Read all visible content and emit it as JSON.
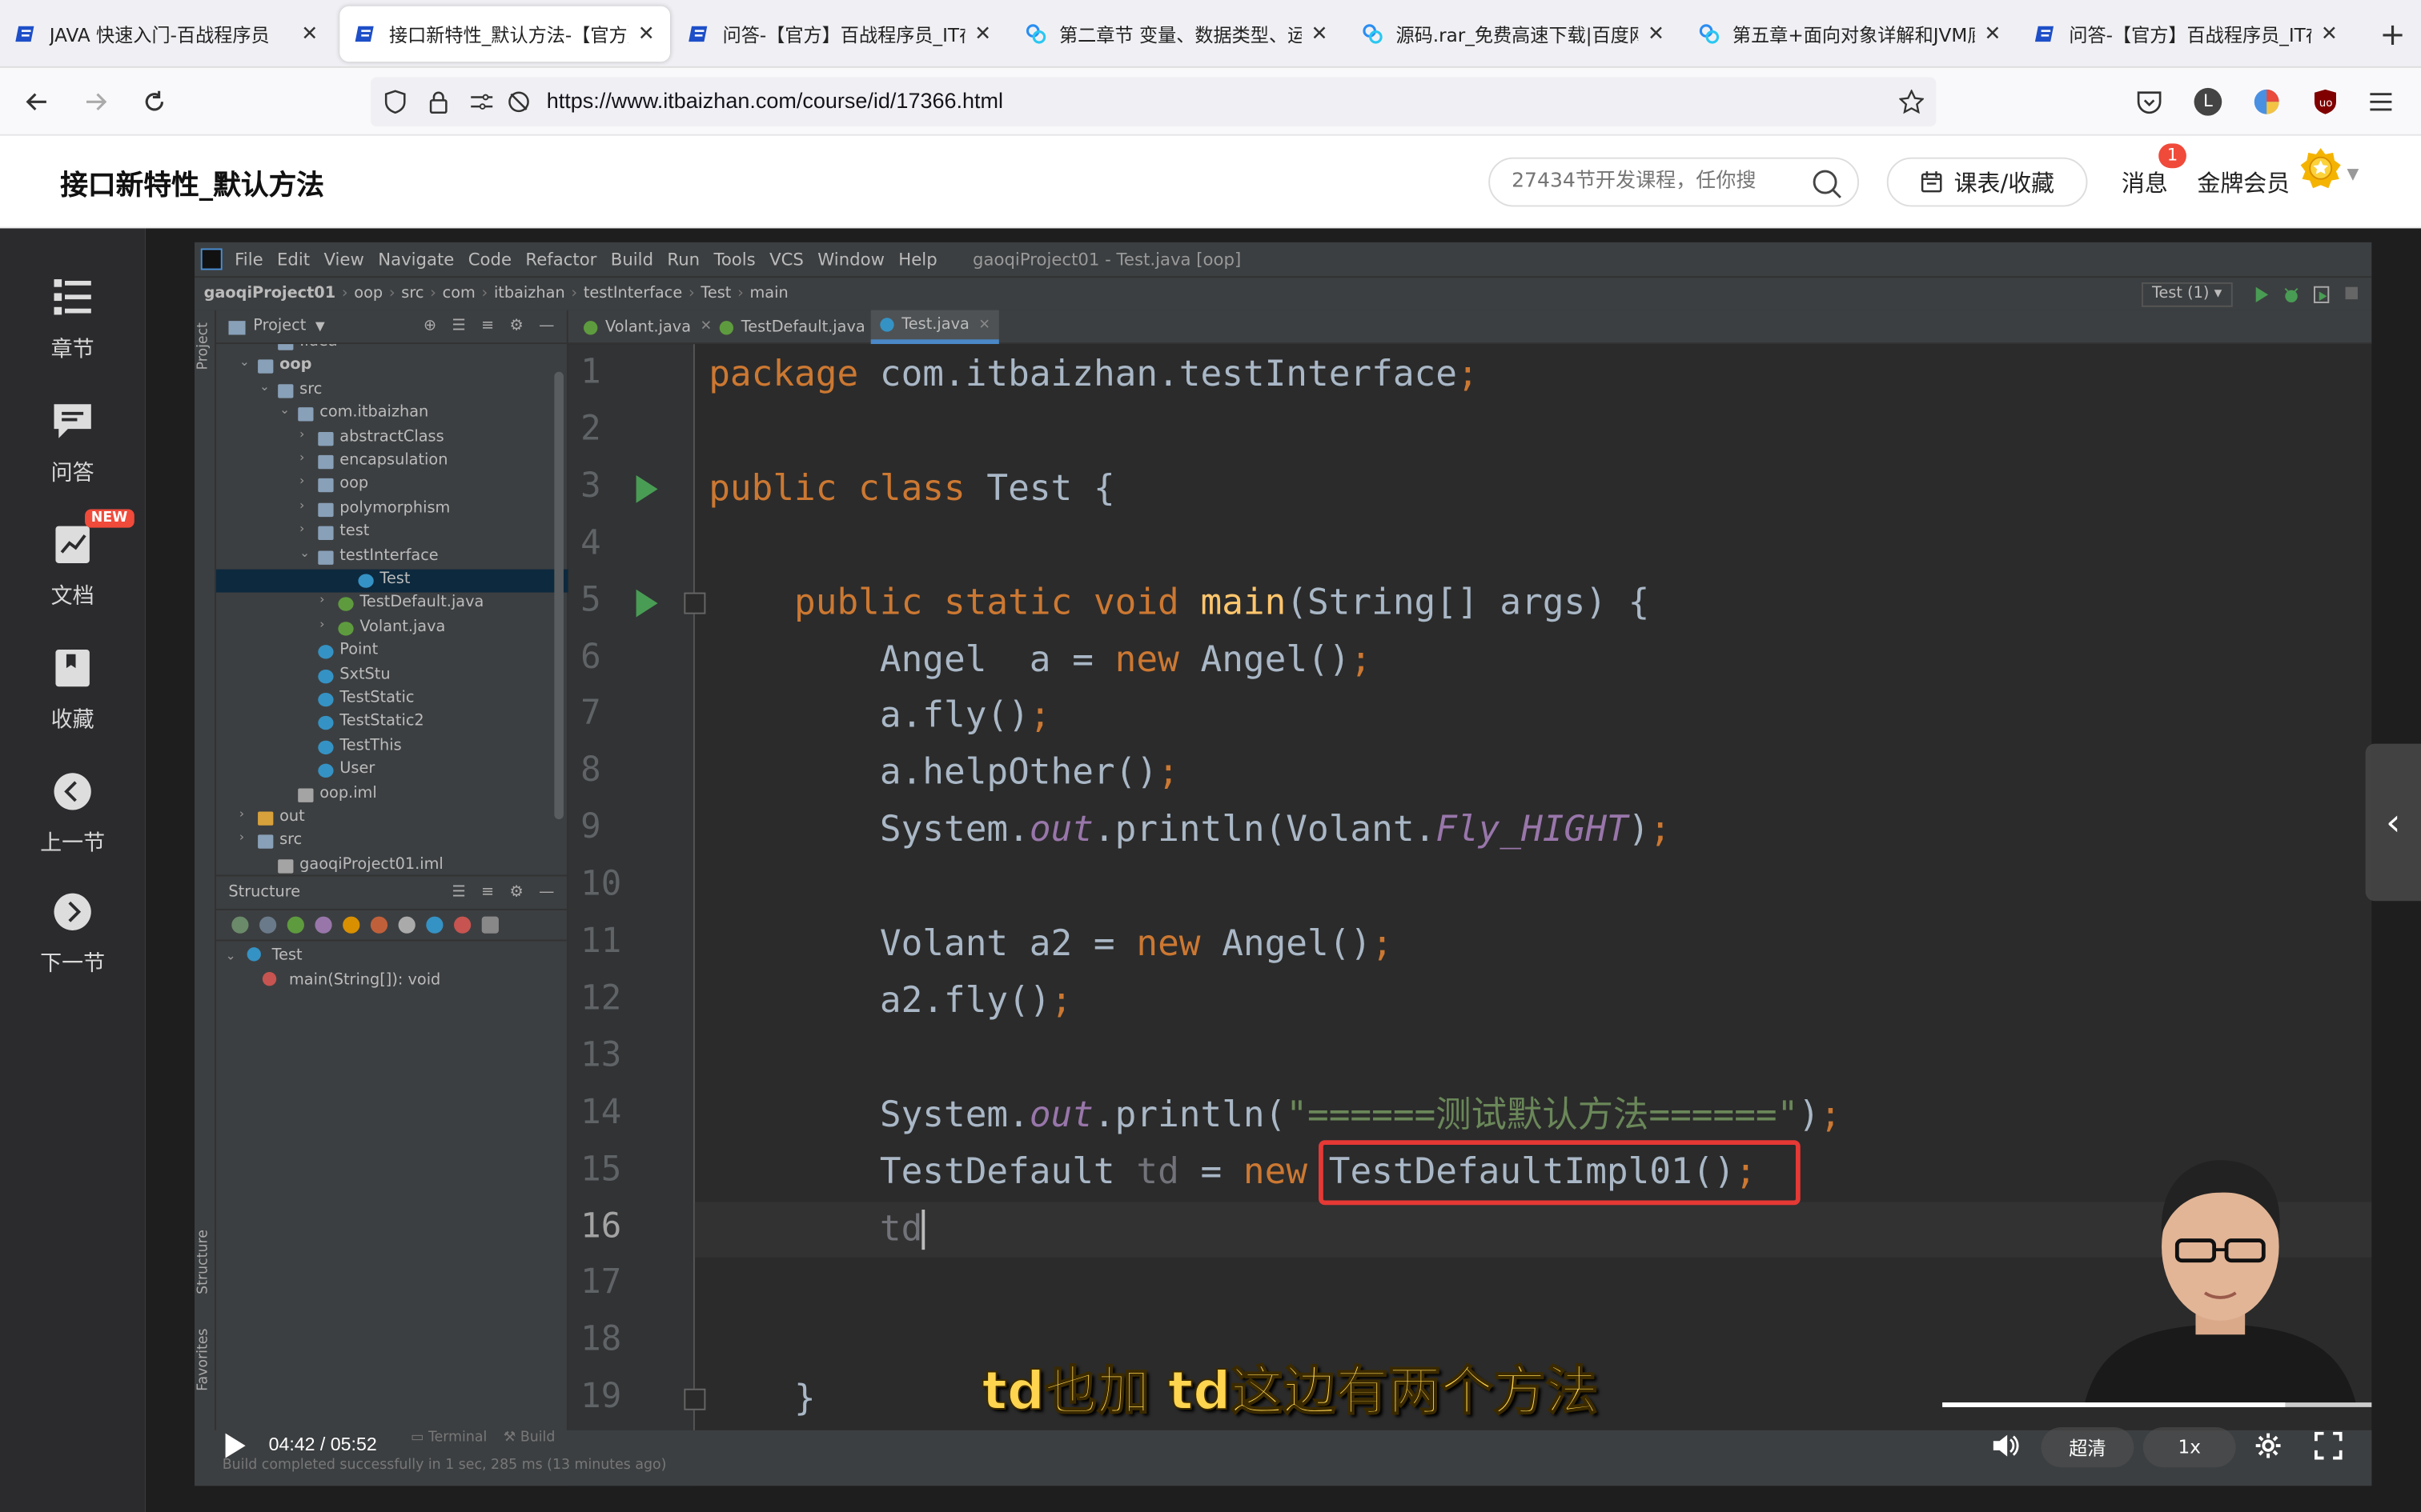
{
  "browser": {
    "tabs": [
      {
        "title": "JAVA 快速入门-百战程序员",
        "icon": "site-logo-icon"
      },
      {
        "title": "接口新特性_默认方法-【官方】",
        "icon": "site-logo-icon",
        "active": true
      },
      {
        "title": "问答-【官方】百战程序员_IT在",
        "icon": "site-logo-icon"
      },
      {
        "title": "第二章节 变量、数据类型、运算",
        "icon": "baidu-netdisk-icon"
      },
      {
        "title": "源码.rar_免费高速下载|百度网盘",
        "icon": "baidu-netdisk-icon"
      },
      {
        "title": "第五章+面向对象详解和JVM底",
        "icon": "baidu-netdisk-icon"
      },
      {
        "title": "问答-【官方】百战程序员_IT在",
        "icon": "site-logo-icon"
      }
    ],
    "url": "https://www.itbaizhan.com/course/id/17366.html",
    "avatar_letter": "L"
  },
  "site": {
    "page_title": "接口新特性_默认方法",
    "search_placeholder": "27434节开发课程，任你搜",
    "schedule_button": "课表/收藏",
    "messages_label": "消息",
    "messages_count": "1",
    "member_label": "金牌会员"
  },
  "sidebar": {
    "items": [
      {
        "label": "章节",
        "icon": "chapter-list-icon"
      },
      {
        "label": "问答",
        "icon": "qa-chat-icon"
      },
      {
        "label": "文档",
        "icon": "document-chart-icon",
        "badge": "NEW"
      },
      {
        "label": "收藏",
        "icon": "bookmark-icon"
      },
      {
        "label": "上一节",
        "icon": "chevron-left-icon"
      },
      {
        "label": "下一节",
        "icon": "chevron-right-icon"
      }
    ]
  },
  "ide": {
    "menu": [
      "File",
      "Edit",
      "View",
      "Navigate",
      "Code",
      "Refactor",
      "Build",
      "Run",
      "Tools",
      "VCS",
      "Window",
      "Help"
    ],
    "window_title": "gaoqiProject01 - Test.java [oop]",
    "breadcrumb": [
      "gaoqiProject01",
      "oop",
      "src",
      "com",
      "itbaizhan",
      "testInterface",
      "Test",
      "main"
    ],
    "run_config": "Test (1)",
    "project_panel_title": "Project",
    "structure_panel_title": "Structure",
    "side_labels": {
      "project": "Project",
      "structure": "Structure",
      "favorites": "Favorites"
    },
    "tree": [
      {
        "label": ".idea",
        "indent": 2,
        "icon": "folder",
        "arrow": "›"
      },
      {
        "label": "oop",
        "indent": 1,
        "icon": "folder",
        "arrow": "⌄",
        "bold": true
      },
      {
        "label": "src",
        "indent": 2,
        "icon": "folder",
        "arrow": "⌄"
      },
      {
        "label": "com.itbaizhan",
        "indent": 3,
        "icon": "folder",
        "arrow": "⌄"
      },
      {
        "label": "abstractClass",
        "indent": 4,
        "icon": "folder",
        "arrow": "›"
      },
      {
        "label": "encapsulation",
        "indent": 4,
        "icon": "folder",
        "arrow": "›"
      },
      {
        "label": "oop",
        "indent": 4,
        "icon": "folder",
        "arrow": "›"
      },
      {
        "label": "polymorphism",
        "indent": 4,
        "icon": "folder",
        "arrow": "›"
      },
      {
        "label": "test",
        "indent": 4,
        "icon": "folder",
        "arrow": "›"
      },
      {
        "label": "testInterface",
        "indent": 4,
        "icon": "folder",
        "arrow": "⌄"
      },
      {
        "label": "Test",
        "indent": 6,
        "icon": "cls",
        "arrow": "",
        "selected": true
      },
      {
        "label": "TestDefault.java",
        "indent": 5,
        "icon": "iface",
        "arrow": "›"
      },
      {
        "label": "Volant.java",
        "indent": 5,
        "icon": "iface",
        "arrow": "›"
      },
      {
        "label": "Point",
        "indent": 4,
        "icon": "cls",
        "arrow": ""
      },
      {
        "label": "SxtStu",
        "indent": 4,
        "icon": "cls",
        "arrow": ""
      },
      {
        "label": "TestStatic",
        "indent": 4,
        "icon": "cls",
        "arrow": ""
      },
      {
        "label": "TestStatic2",
        "indent": 4,
        "icon": "cls",
        "arrow": ""
      },
      {
        "label": "TestThis",
        "indent": 4,
        "icon": "cls",
        "arrow": ""
      },
      {
        "label": "User",
        "indent": 4,
        "icon": "cls",
        "arrow": ""
      },
      {
        "label": "oop.iml",
        "indent": 3,
        "icon": "iml",
        "arrow": ""
      },
      {
        "label": "out",
        "indent": 1,
        "icon": "folder orange",
        "arrow": "›"
      },
      {
        "label": "src",
        "indent": 1,
        "icon": "folder",
        "arrow": "›"
      },
      {
        "label": "gaoqiProject01.iml",
        "indent": 2,
        "icon": "iml",
        "arrow": ""
      }
    ],
    "structure": {
      "class": "Test",
      "method": "main(String[]): void"
    },
    "editor_tabs": [
      "Volant.java",
      "TestDefault.java",
      "Test.java"
    ],
    "active_tab": 2,
    "code": [
      {
        "n": "1",
        "html": "<span class=\"kw\">package</span> com.itbaizhan.testInterface<span class=\"kw\">;</span>"
      },
      {
        "n": "2",
        "html": ""
      },
      {
        "n": "3",
        "html": "<span class=\"kw\">public class</span> Test {",
        "run": true
      },
      {
        "n": "4",
        "html": ""
      },
      {
        "n": "5",
        "html": "    <span class=\"kw\">public static void</span> <span class=\"fn\">main</span>(String[] args) {",
        "run": true,
        "fold": true
      },
      {
        "n": "6",
        "html": "        Angel  a = <span class=\"kw\">new</span> Angel()<span class=\"kw\">;</span>"
      },
      {
        "n": "7",
        "html": "        a.fly()<span class=\"kw\">;</span>"
      },
      {
        "n": "8",
        "html": "        a.helpOther()<span class=\"kw\">;</span>"
      },
      {
        "n": "9",
        "html": "        System.<span class=\"fld\">out</span>.println(Volant.<span class=\"fld\">Fly_HIGHT</span>)<span class=\"kw\">;</span>"
      },
      {
        "n": "10",
        "html": ""
      },
      {
        "n": "11",
        "html": "        Volant a2 = <span class=\"kw\">new</span> Angel()<span class=\"kw\">;</span>"
      },
      {
        "n": "12",
        "html": "        a2.fly()<span class=\"kw\">;</span>"
      },
      {
        "n": "13",
        "html": ""
      },
      {
        "n": "14",
        "html": "        System.<span class=\"fld\">out</span>.println(<span class=\"st\">\"======测试默认方法======\"</span>)<span class=\"kw\">;</span>"
      },
      {
        "n": "15",
        "html": "        TestDefault <span class=\"unused\">td</span> = <span class=\"kw\">new</span> TestDefaultImpl01()<span class=\"kw\">;</span>"
      },
      {
        "n": "16",
        "html": "        <span class=\"unused\">td</span><span class=\"caretbar\"></span>",
        "current": true
      },
      {
        "n": "17",
        "html": ""
      },
      {
        "n": "18",
        "html": ""
      },
      {
        "n": "19",
        "html": "    }",
        "fold": true
      }
    ],
    "status_message": "Build completed successfully in 1 sec, 285 ms (13 minutes ago)",
    "status_tabs": [
      "Terminal",
      "Build"
    ]
  },
  "video": {
    "subtitle": "td也加 td这边有两个方法",
    "time": "04:42 / 05:52",
    "progress": 0.8,
    "quality": "超清",
    "speed": "1x"
  }
}
